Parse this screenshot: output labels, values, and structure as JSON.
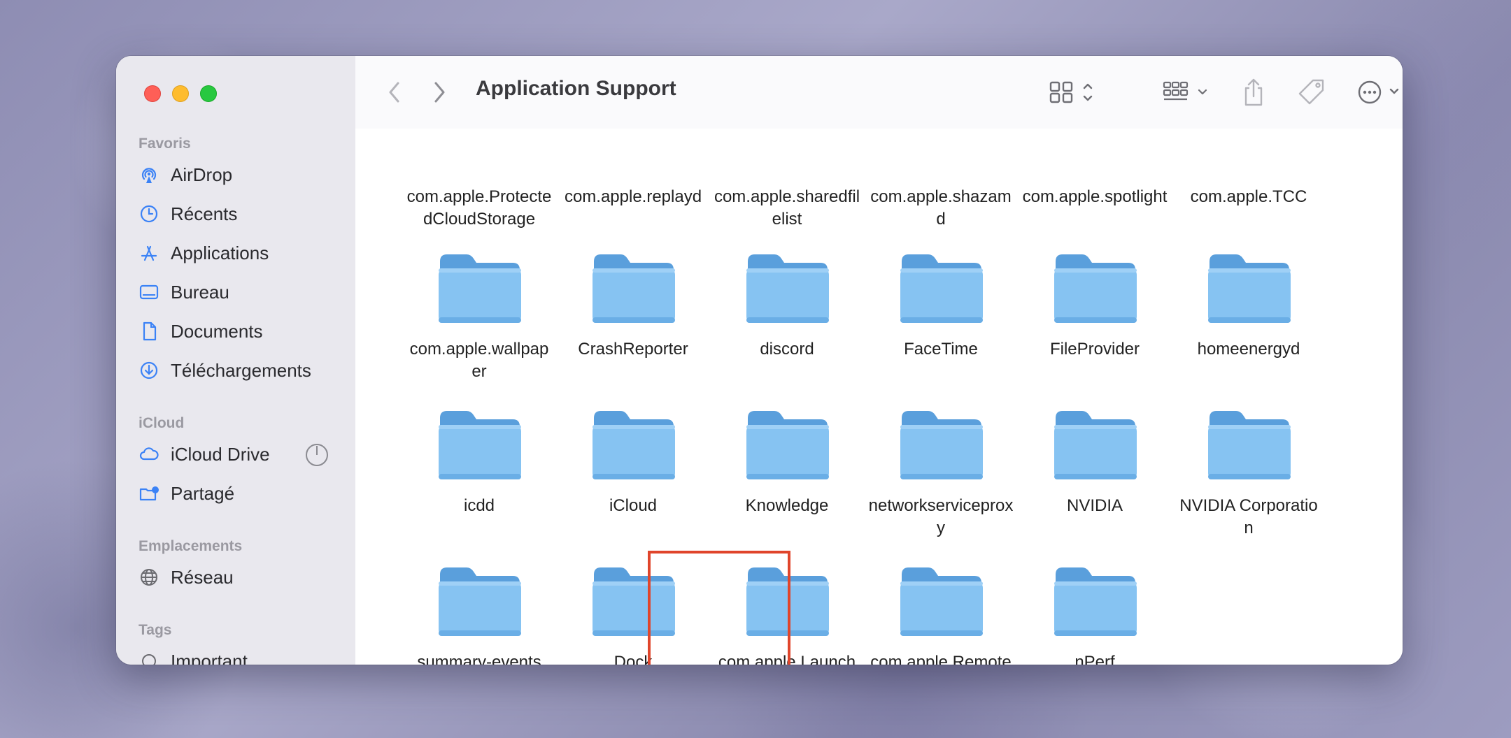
{
  "window": {
    "title": "Application Support"
  },
  "sidebar": {
    "sections": [
      {
        "heading": "Favoris",
        "items": [
          {
            "label": "AirDrop",
            "icon": "airdrop-icon"
          },
          {
            "label": "Récents",
            "icon": "clock-icon"
          },
          {
            "label": "Applications",
            "icon": "applications-icon"
          },
          {
            "label": "Bureau",
            "icon": "desktop-icon"
          },
          {
            "label": "Documents",
            "icon": "document-icon"
          },
          {
            "label": "Téléchargements",
            "icon": "download-icon"
          }
        ]
      },
      {
        "heading": "iCloud",
        "items": [
          {
            "label": "iCloud Drive",
            "icon": "cloud-icon"
          },
          {
            "label": "Partagé",
            "icon": "shared-folder-icon"
          }
        ]
      },
      {
        "heading": "Emplacements",
        "items": [
          {
            "label": "Réseau",
            "icon": "globe-icon"
          }
        ]
      },
      {
        "heading": "Tags",
        "items": [
          {
            "label": "Important",
            "icon": "tag-circle-icon"
          }
        ]
      }
    ]
  },
  "toolbar": {
    "icons": [
      "back-icon",
      "forward-icon",
      "icon-view-icon",
      "group-icon",
      "share-icon",
      "tag-icon",
      "more-icon",
      "search-icon"
    ]
  },
  "files": {
    "top_row": [
      "com.apple.ProtectedCloudStorage",
      "com.apple.replayd",
      "com.apple.sharedfilelist",
      "com.apple.shazamd",
      "com.apple.spotlight",
      "com.apple.TCC"
    ],
    "rows": [
      [
        "com.apple.wallpaper",
        "CrashReporter",
        "discord",
        "FaceTime",
        "FileProvider",
        "homeenergyd"
      ],
      [
        "icdd",
        "iCloud",
        "Knowledge",
        "networkserviceproxy",
        "NVIDIA",
        "NVIDIA Corporation"
      ],
      [
        "summary-events",
        "Dock",
        "com.apple.LaunchServic…teApp.dv",
        "com.apple.RemoteManag…ntAgent",
        "nPerf"
      ]
    ],
    "highlighted": "Dock",
    "folder_color": "#7ab8ec",
    "highlight_color": "#e0452b"
  }
}
